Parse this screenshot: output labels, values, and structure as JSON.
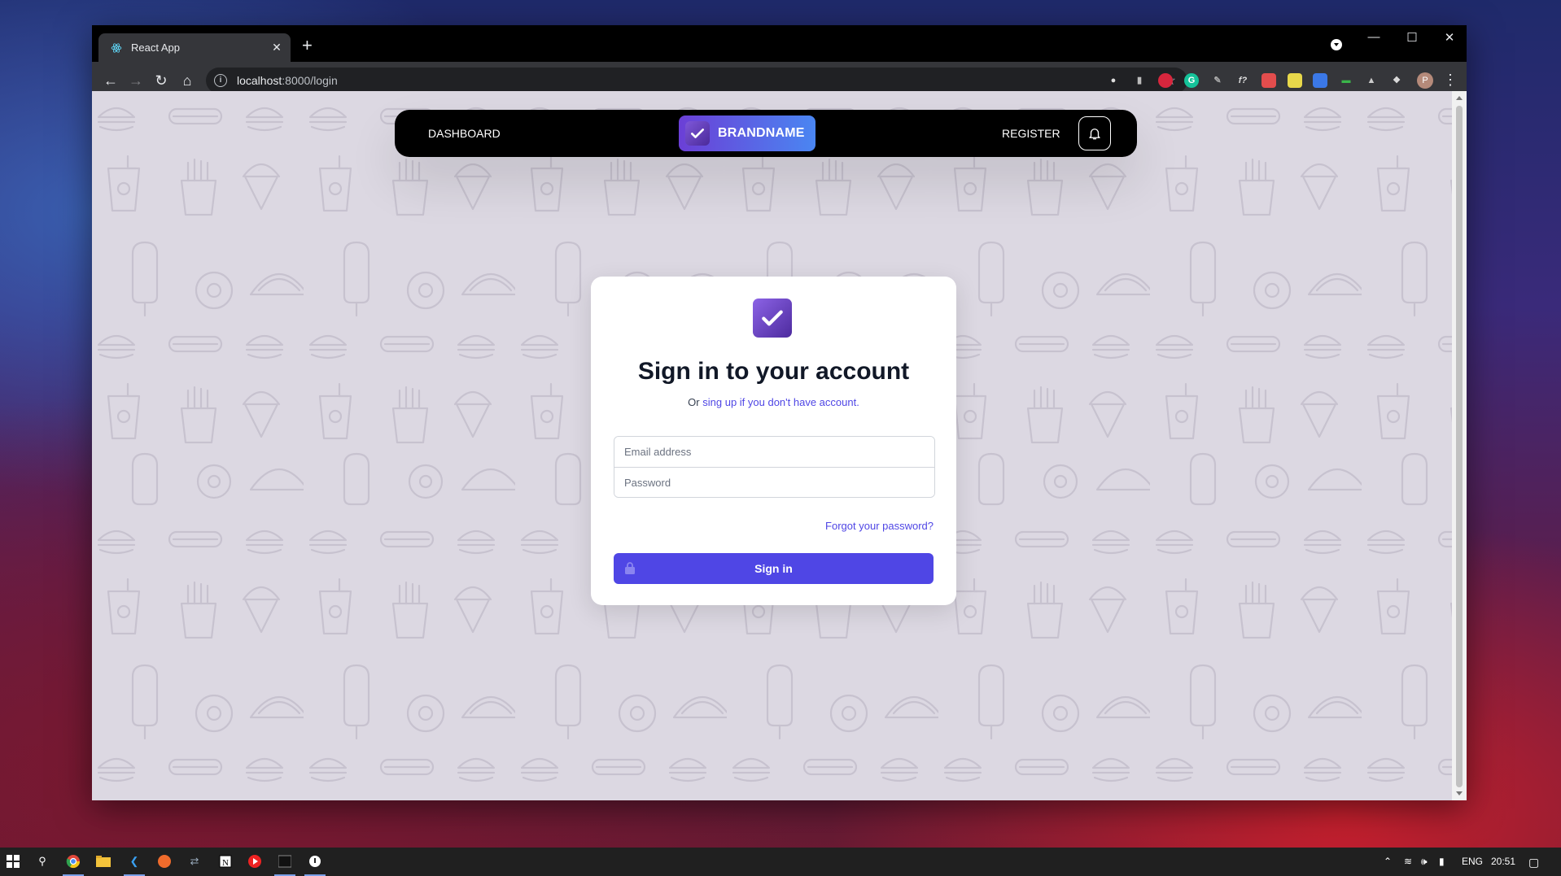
{
  "browser": {
    "tab_title": "React App",
    "url_host": "localhost",
    "url_path": ":8000/login",
    "new_tab": "+",
    "close_tab": "✕"
  },
  "nav": {
    "dashboard": "DASHBOARD",
    "brand": "BRANDNAME",
    "register": "REGISTER"
  },
  "login": {
    "title": "Sign in to your account",
    "sub_prefix": "Or",
    "sub_link": "sing up if you don't have account.",
    "email_placeholder": "Email address",
    "password_placeholder": "Password",
    "forgot": "Forgot your password?",
    "button": "Sign in"
  },
  "taskbar": {
    "lang": "ENG",
    "time": "20:51"
  },
  "colors": {
    "accent": "#4f46e5",
    "brand_from": "#6b3fd6",
    "brand_to": "#4a86f2",
    "page_bg": "#dcd8e2"
  }
}
